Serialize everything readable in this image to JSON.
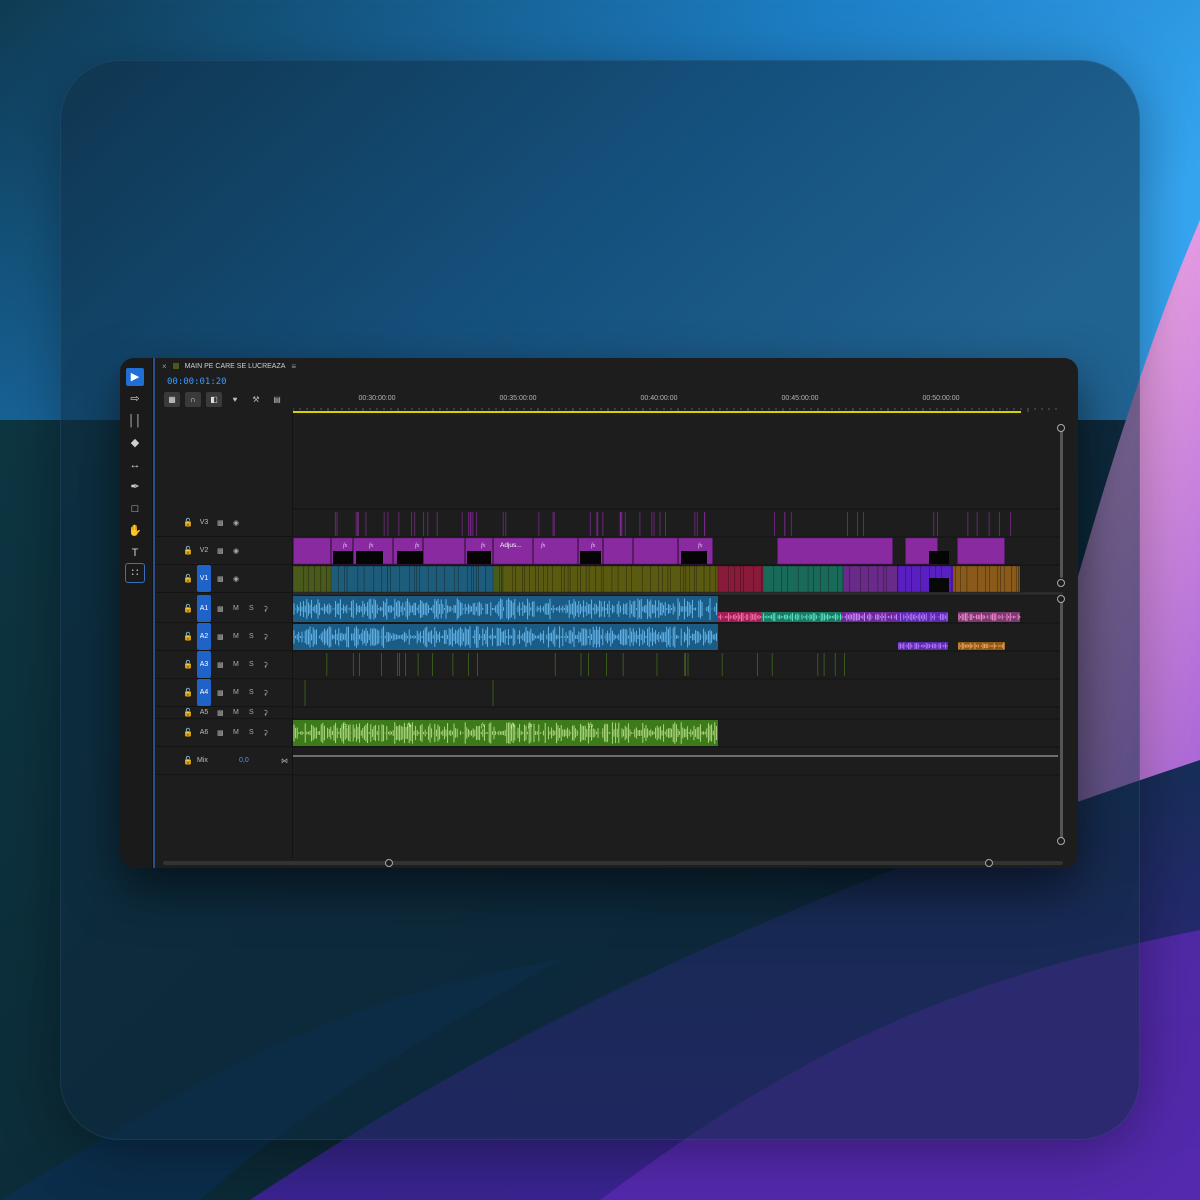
{
  "colors": {
    "accent": "#1f6fd6",
    "timecode": "#3d9bff",
    "work_area": "#d8d200",
    "v2_clip": "#8a2aa0",
    "v1_clip": "#3a5a1a",
    "a_blue": "#1a5c85",
    "a6_green": "#3d7a1a",
    "pink": "#d0356f",
    "teal": "#1f8f75",
    "violet": "#7a2fd0",
    "orange": "#b0661a"
  },
  "toolbar": {
    "tools": [
      "selection-tool-icon",
      "track-select-icon",
      "ripple-edit-icon",
      "razor-icon",
      "slip-icon",
      "pen-icon",
      "rectangle-icon",
      "hand-icon",
      "type-icon",
      "remix-icon"
    ]
  },
  "panel": {
    "close": "×",
    "title": "MAIN PE CARE SE LUCREAZA",
    "menu": "≡"
  },
  "timecode": "00:00:01:20",
  "ruler": {
    "labels": [
      "00:30:00:00",
      "00:35:00:00",
      "00:40:00:00",
      "00:45:00:00",
      "00:50:00:00"
    ]
  },
  "video_tracks": [
    {
      "name": "V3"
    },
    {
      "name": "V2"
    },
    {
      "name": "V1"
    }
  ],
  "audio_tracks": [
    {
      "name": "A1",
      "m": "M",
      "s": "S"
    },
    {
      "name": "A2",
      "m": "M",
      "s": "S"
    },
    {
      "name": "A3",
      "m": "M",
      "s": "S"
    },
    {
      "name": "A4",
      "m": "M",
      "s": "S"
    },
    {
      "name": "A5",
      "m": "M",
      "s": "S"
    },
    {
      "name": "A6",
      "m": "M",
      "s": "S"
    }
  ],
  "mix": {
    "label": "Mix",
    "value": "0,0"
  },
  "clip_labels": {
    "fx": "fx",
    "adjustment": "Adjus..."
  }
}
